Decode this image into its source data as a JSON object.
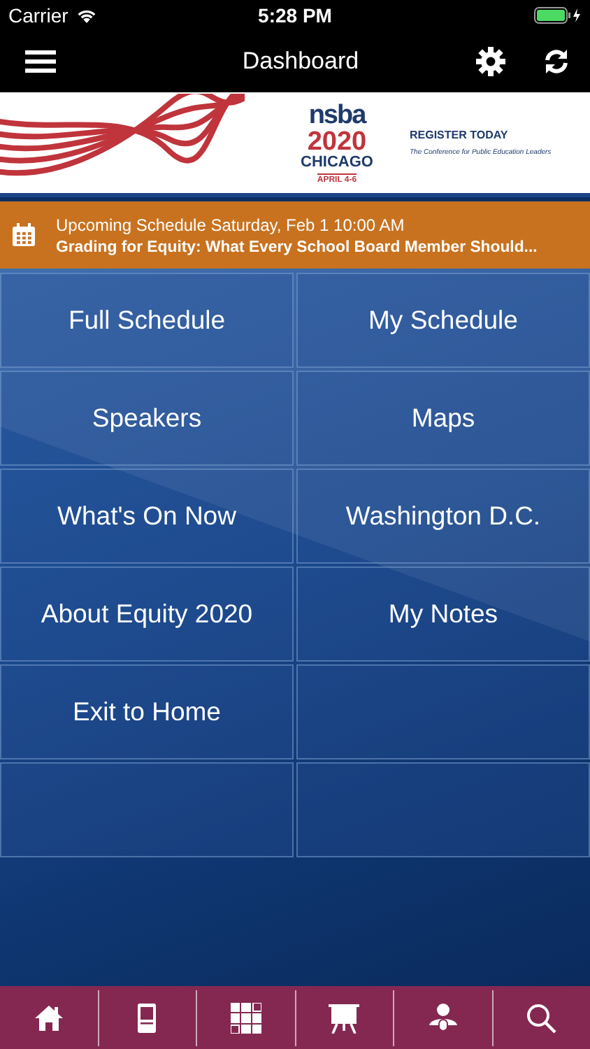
{
  "status_bar": {
    "carrier": "Carrier",
    "time": "5:28 PM"
  },
  "nav_bar": {
    "title": "Dashboard"
  },
  "banner": {
    "logo": "nsba",
    "year": "2020",
    "city": "CHICAGO",
    "dates": "APRIL 4-6",
    "cta": "REGISTER TODAY",
    "tagline": "The Conference for Public Education Leaders"
  },
  "upcoming": {
    "heading": "Upcoming Schedule Saturday, Feb 1 10:00 AM",
    "title": "Grading for Equity: What Every School Board Member Should..."
  },
  "tiles": [
    {
      "label": "Full Schedule"
    },
    {
      "label": "My Schedule"
    },
    {
      "label": "Speakers"
    },
    {
      "label": "Maps"
    },
    {
      "label": "What's On Now"
    },
    {
      "label": "Washington D.C."
    },
    {
      "label": "About Equity 2020"
    },
    {
      "label": "My Notes"
    },
    {
      "label": "Exit to Home"
    }
  ],
  "tab_bar": [
    {
      "kind": "home"
    },
    {
      "kind": "kiosk"
    },
    {
      "kind": "grid"
    },
    {
      "kind": "easel"
    },
    {
      "kind": "person"
    },
    {
      "kind": "search"
    }
  ]
}
